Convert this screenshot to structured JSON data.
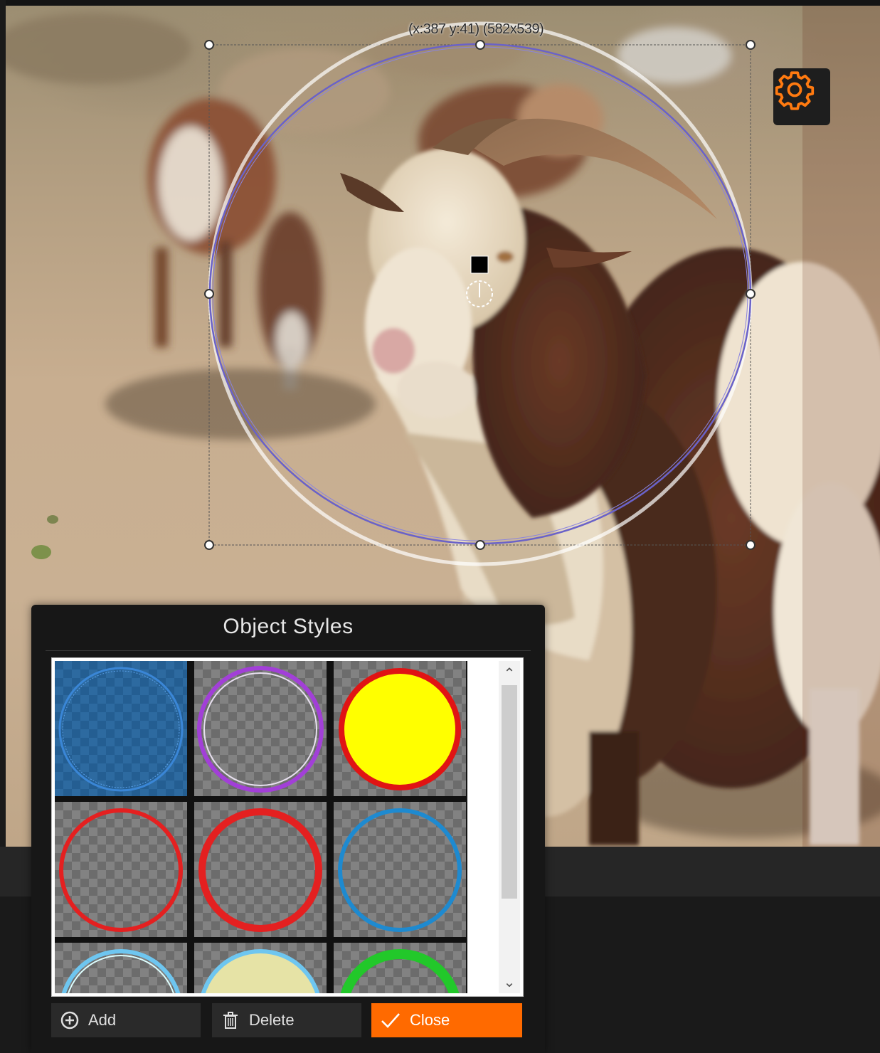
{
  "canvas": {
    "selection_readout": "(x:387 y:41) (582x539)",
    "settings_icon": "gear-icon",
    "accent_color": "#ff6a00"
  },
  "object_styles": {
    "title": "Object Styles",
    "styles": [
      {
        "name": "blue-outline",
        "fill": "transparent",
        "ring": "#3a86d6",
        "selected": true
      },
      {
        "name": "purple-ring",
        "fill": "transparent",
        "ring": "#a23fd8",
        "selected": false
      },
      {
        "name": "yellow-red",
        "fill": "#ffff00",
        "ring": "#e01414",
        "selected": false
      },
      {
        "name": "red-thin",
        "fill": "transparent",
        "ring": "#e42020",
        "selected": false
      },
      {
        "name": "red-thick",
        "fill": "transparent",
        "ring": "#e42020",
        "selected": false
      },
      {
        "name": "blue-ring",
        "fill": "transparent",
        "ring": "#1e8ad0",
        "selected": false
      },
      {
        "name": "lightblue-ring",
        "fill": "transparent",
        "ring": "#6ec6f0",
        "selected": false
      },
      {
        "name": "cream-fill",
        "fill": "#e6e3a6",
        "ring": "#6ec6f0",
        "selected": false
      },
      {
        "name": "green-ring",
        "fill": "transparent",
        "ring": "#22c82a",
        "selected": false
      }
    ],
    "buttons": {
      "add_label": "Add",
      "delete_label": "Delete",
      "close_label": "Close"
    }
  }
}
